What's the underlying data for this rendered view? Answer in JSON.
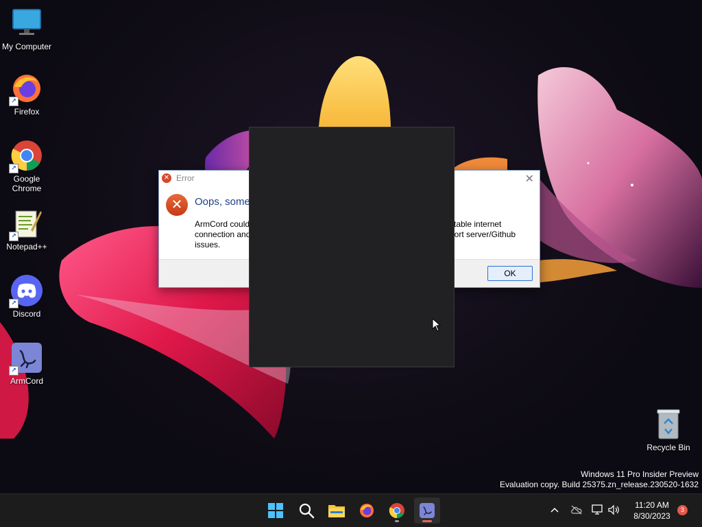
{
  "desktop": {
    "icons": [
      {
        "label": "My Computer",
        "icon": "monitor-icon"
      },
      {
        "label": "Firefox",
        "icon": "firefox-icon"
      },
      {
        "label": "Google Chrome",
        "icon": "chrome-icon"
      },
      {
        "label": "Notepad++",
        "icon": "notepadpp-icon"
      },
      {
        "label": "Discord",
        "icon": "discord-icon"
      },
      {
        "label": "ArmCord",
        "icon": "armcord-icon"
      }
    ],
    "recycle_bin": {
      "label": "Recycle Bin",
      "icon": "recycle-bin-icon"
    }
  },
  "dialog": {
    "title": "Error",
    "heading": "Oops, some",
    "message_left_1": "ArmCord could",
    "message_left_2": "connection and",
    "message_left_3": "issues.",
    "message_right_1": "table internet",
    "message_right_2": "port server/Github",
    "ok_label": "OK",
    "close_glyph": "✕"
  },
  "watermark": {
    "line1": "Windows 11 Pro Insider Preview",
    "line2": "Evaluation copy. Build 25375.zn_release.230520-1632"
  },
  "taskbar": {
    "apps": [
      "start-icon",
      "search-icon",
      "file-explorer-icon",
      "firefox-icon",
      "chrome-icon",
      "armcord-icon"
    ],
    "clock_time": "11:20 AM",
    "clock_date": "8/30/2023",
    "notification_count": "3"
  },
  "colors": {
    "accent": "#2d6fd0",
    "error": "#d9482b",
    "taskbar": "#1c1c1c"
  }
}
